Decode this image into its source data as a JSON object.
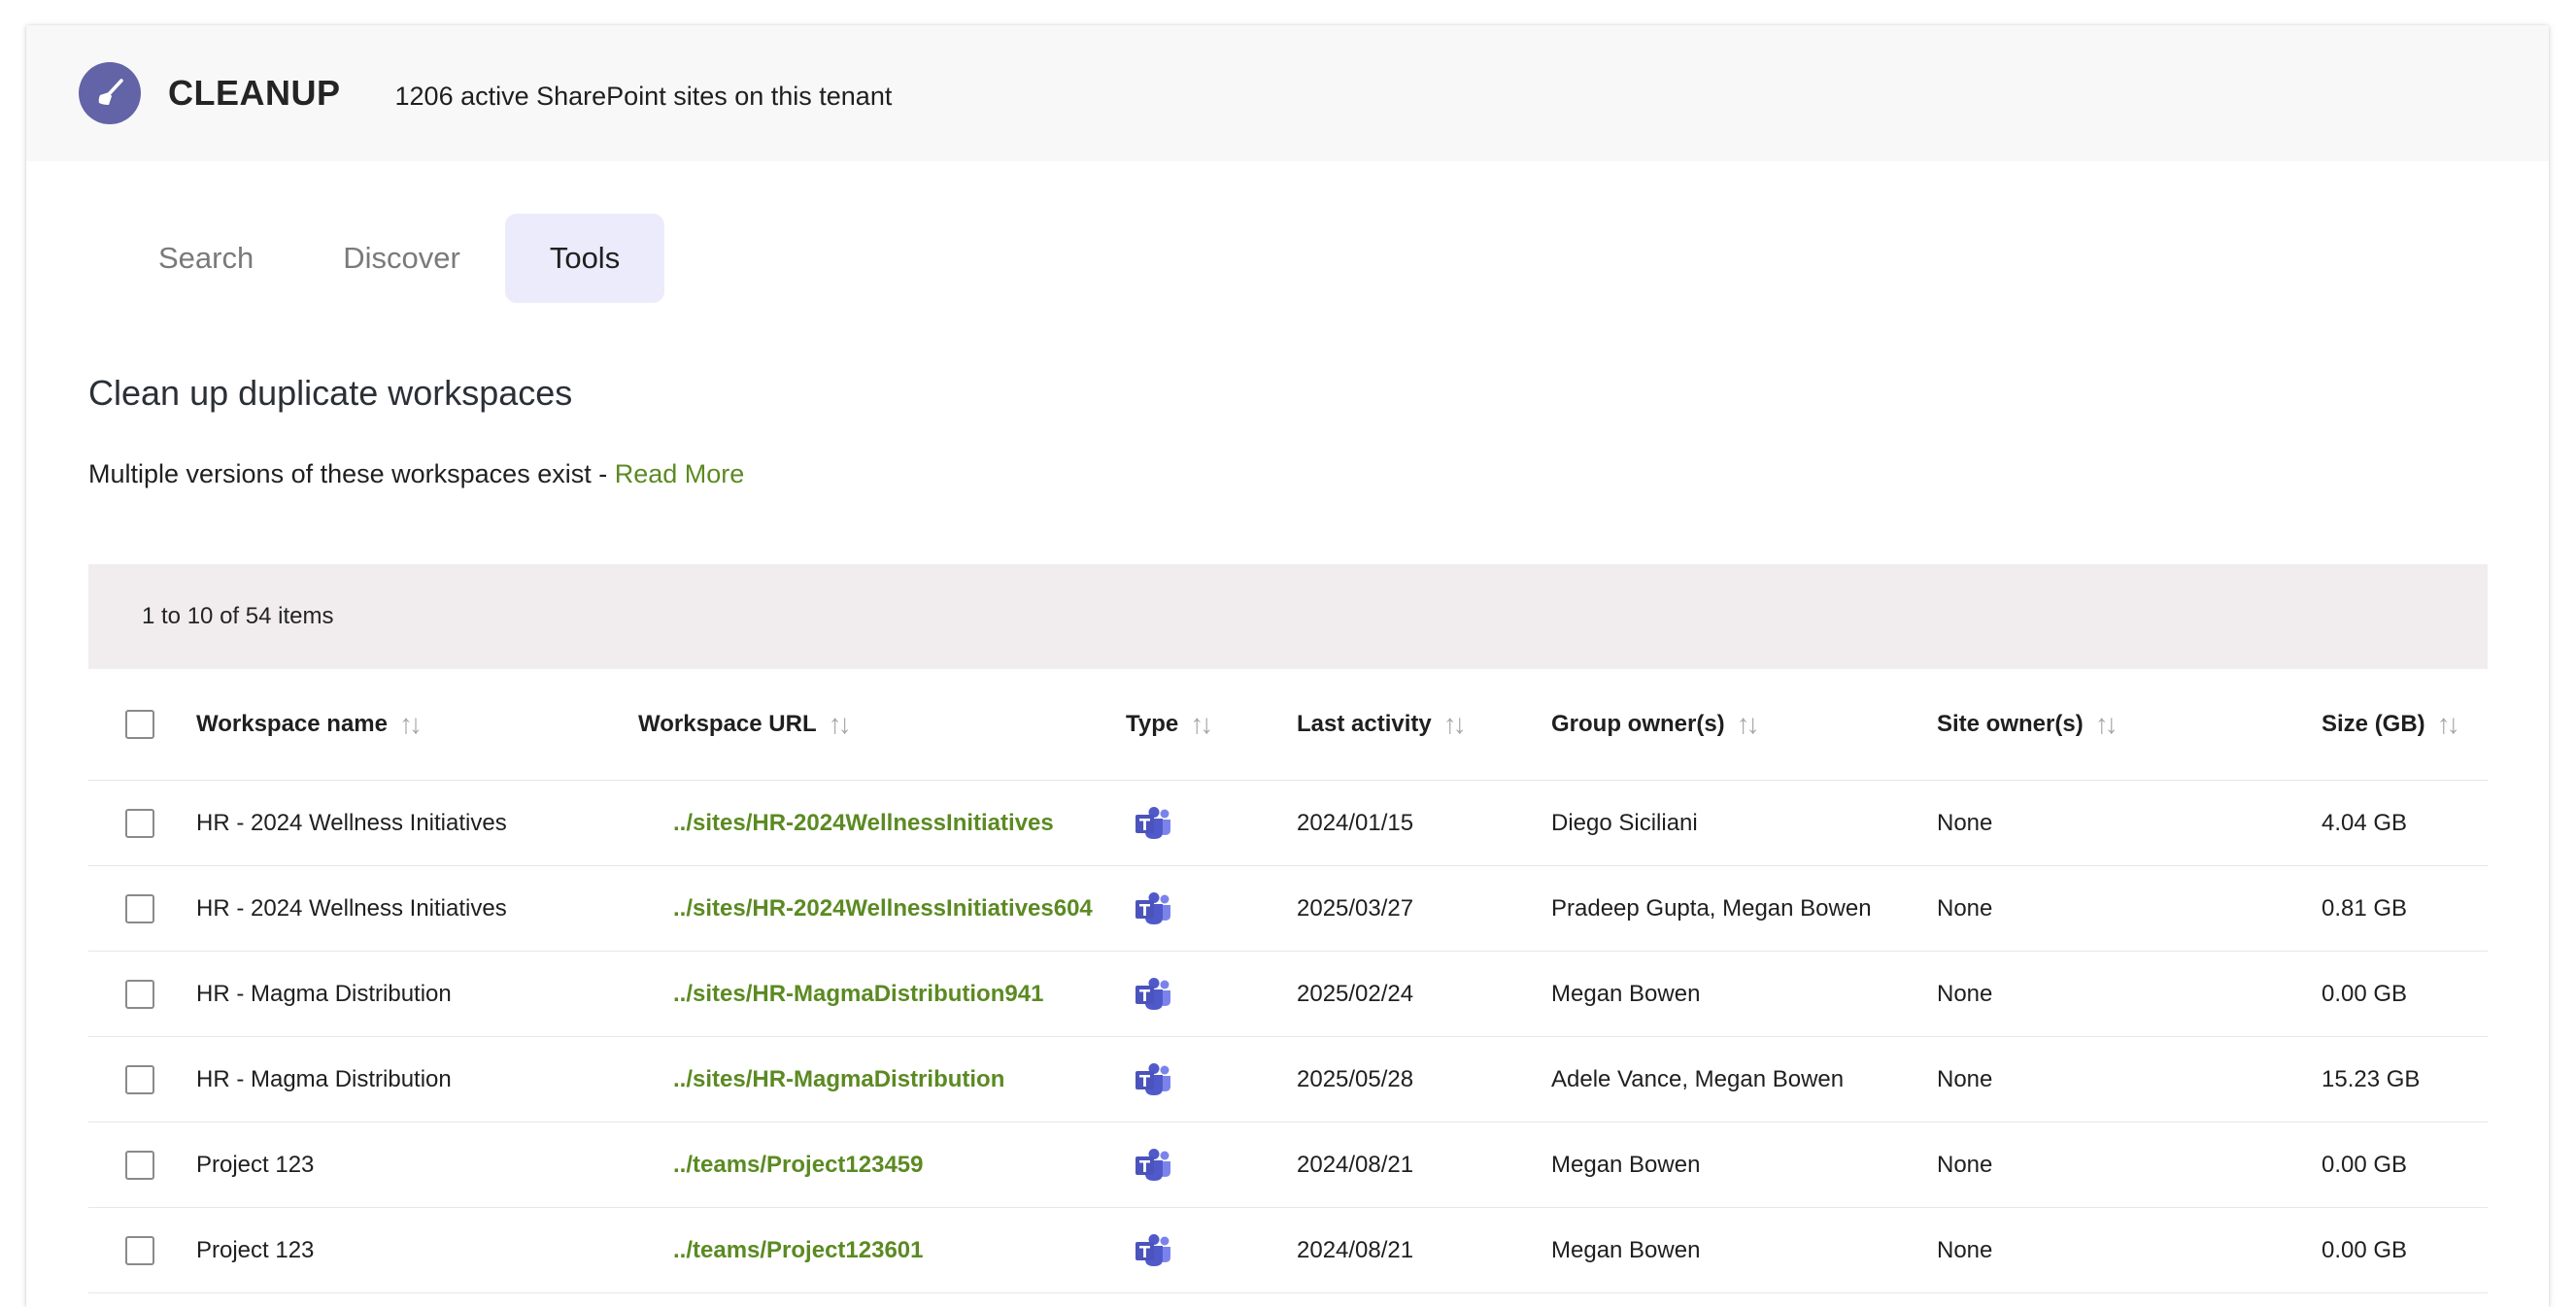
{
  "app": {
    "title": "CLEANUP",
    "subtitle": "1206 active SharePoint sites on this tenant"
  },
  "tabs": [
    {
      "label": "Search",
      "active": false
    },
    {
      "label": "Discover",
      "active": false
    },
    {
      "label": "Tools",
      "active": true
    }
  ],
  "section": {
    "title": "Clean up duplicate workspaces",
    "description": "Multiple versions of these workspaces exist - ",
    "read_more": "Read More"
  },
  "table": {
    "pagination": "1 to 10 of 54 items",
    "columns": [
      "Workspace name",
      "Workspace URL",
      "Type",
      "Last activity",
      "Group owner(s)",
      "Site owner(s)",
      "Size (GB)"
    ],
    "sort_glyph": "↑↓",
    "rows": [
      {
        "name": "HR - 2024 Wellness Initiatives",
        "url": "../sites/HR-2024WellnessInitiatives",
        "type": "teams-icon",
        "last_activity": "2024/01/15",
        "group_owners": "Diego Siciliani",
        "site_owners": "None",
        "size": "4.04 GB"
      },
      {
        "name": "HR - 2024 Wellness Initiatives",
        "url": "../sites/HR-2024WellnessInitiatives604",
        "type": "teams-icon",
        "last_activity": "2025/03/27",
        "group_owners": "Pradeep Gupta, Megan Bowen",
        "site_owners": "None",
        "size": "0.81 GB"
      },
      {
        "name": "HR - Magma Distribution",
        "url": "../sites/HR-MagmaDistribution941",
        "type": "teams-icon",
        "last_activity": "2025/02/24",
        "group_owners": "Megan Bowen",
        "site_owners": "None",
        "size": "0.00 GB"
      },
      {
        "name": "HR - Magma Distribution",
        "url": "../sites/HR-MagmaDistribution",
        "type": "teams-icon",
        "last_activity": "2025/05/28",
        "group_owners": "Adele Vance, Megan Bowen",
        "site_owners": "None",
        "size": "15.23 GB"
      },
      {
        "name": "Project 123",
        "url": "../teams/Project123459",
        "type": "teams-icon",
        "last_activity": "2024/08/21",
        "group_owners": "Megan Bowen",
        "site_owners": "None",
        "size": "0.00 GB"
      },
      {
        "name": "Project 123",
        "url": "../teams/Project123601",
        "type": "teams-icon",
        "last_activity": "2024/08/21",
        "group_owners": "Megan Bowen",
        "site_owners": "None",
        "size": "0.00 GB"
      }
    ]
  },
  "colors": {
    "brand": "#6264a7",
    "link": "#5b8a22",
    "active_tab_bg": "#ebebfb",
    "toolbar_bg": "#f1edee",
    "header_bg": "#f8f8f8"
  },
  "icons": {
    "logo": "broom-icon",
    "sort": "sort-arrows-icon",
    "type": "teams-icon"
  }
}
